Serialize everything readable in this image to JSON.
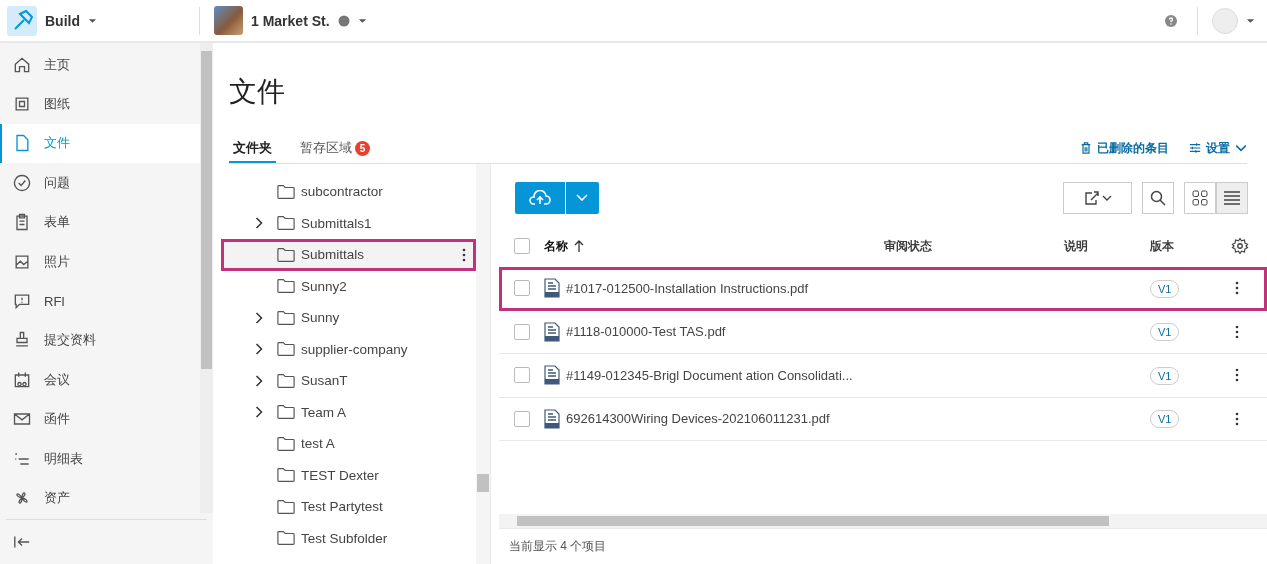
{
  "header": {
    "app": "Build",
    "project": "1 Market St."
  },
  "sidebar": {
    "items": [
      {
        "label": "主页",
        "selected": false
      },
      {
        "label": "图纸",
        "selected": false
      },
      {
        "label": "文件",
        "selected": true
      },
      {
        "label": "问题",
        "selected": false
      },
      {
        "label": "表单",
        "selected": false
      },
      {
        "label": "照片",
        "selected": false
      },
      {
        "label": "RFI",
        "selected": false
      },
      {
        "label": "提交资料",
        "selected": false
      },
      {
        "label": "会议",
        "selected": false
      },
      {
        "label": "函件",
        "selected": false
      },
      {
        "label": "明细表",
        "selected": false
      },
      {
        "label": "资产",
        "selected": false
      }
    ]
  },
  "page_title": "文件",
  "tabs": [
    {
      "label": "文件夹",
      "selected": true
    },
    {
      "label": "暂存区域",
      "selected": false,
      "badge": "5"
    }
  ],
  "actions": {
    "deleted": "已删除的条目",
    "settings": "设置"
  },
  "folders": [
    {
      "name": "subcontractor",
      "has_children": false,
      "selected": false,
      "highlighted": false
    },
    {
      "name": "Submittals1",
      "has_children": true,
      "selected": false,
      "highlighted": false
    },
    {
      "name": "Submittals",
      "has_children": false,
      "selected": true,
      "highlighted": true
    },
    {
      "name": "Sunny2",
      "has_children": false,
      "selected": false,
      "highlighted": false
    },
    {
      "name": "Sunny",
      "has_children": true,
      "selected": false,
      "highlighted": false
    },
    {
      "name": "supplier-company",
      "has_children": true,
      "selected": false,
      "highlighted": false
    },
    {
      "name": "SusanT",
      "has_children": true,
      "selected": false,
      "highlighted": false
    },
    {
      "name": "Team A",
      "has_children": true,
      "selected": false,
      "highlighted": false
    },
    {
      "name": "test A",
      "has_children": false,
      "selected": false,
      "highlighted": false
    },
    {
      "name": "TEST Dexter",
      "has_children": false,
      "selected": false,
      "highlighted": false
    },
    {
      "name": "Test Partytest",
      "has_children": false,
      "selected": false,
      "highlighted": false
    },
    {
      "name": "Test Subfolder",
      "has_children": false,
      "selected": false,
      "highlighted": false
    }
  ],
  "table": {
    "select_all_checked": false,
    "columns": [
      {
        "label": "名称",
        "sorted": true
      },
      {
        "label": "审阅状态",
        "sorted": false
      },
      {
        "label": "说明",
        "sorted": false
      },
      {
        "label": "版本",
        "sorted": false
      }
    ],
    "rows": [
      {
        "name": "#1017-012500-Installation Instructions.pdf",
        "version": "V1",
        "checked": false,
        "highlighted": true
      },
      {
        "name": "#1118-010000-Test TAS.pdf",
        "version": "V1",
        "checked": false,
        "highlighted": false
      },
      {
        "name": "#1149-012345-Brigl Document ation Consolidati...",
        "version": "V1",
        "checked": false,
        "highlighted": false
      },
      {
        "name": "692614300Wiring Devices-202106011231.pdf",
        "version": "V1",
        "checked": false,
        "highlighted": false
      }
    ]
  },
  "status_bar": "当前显示 4 个项目"
}
